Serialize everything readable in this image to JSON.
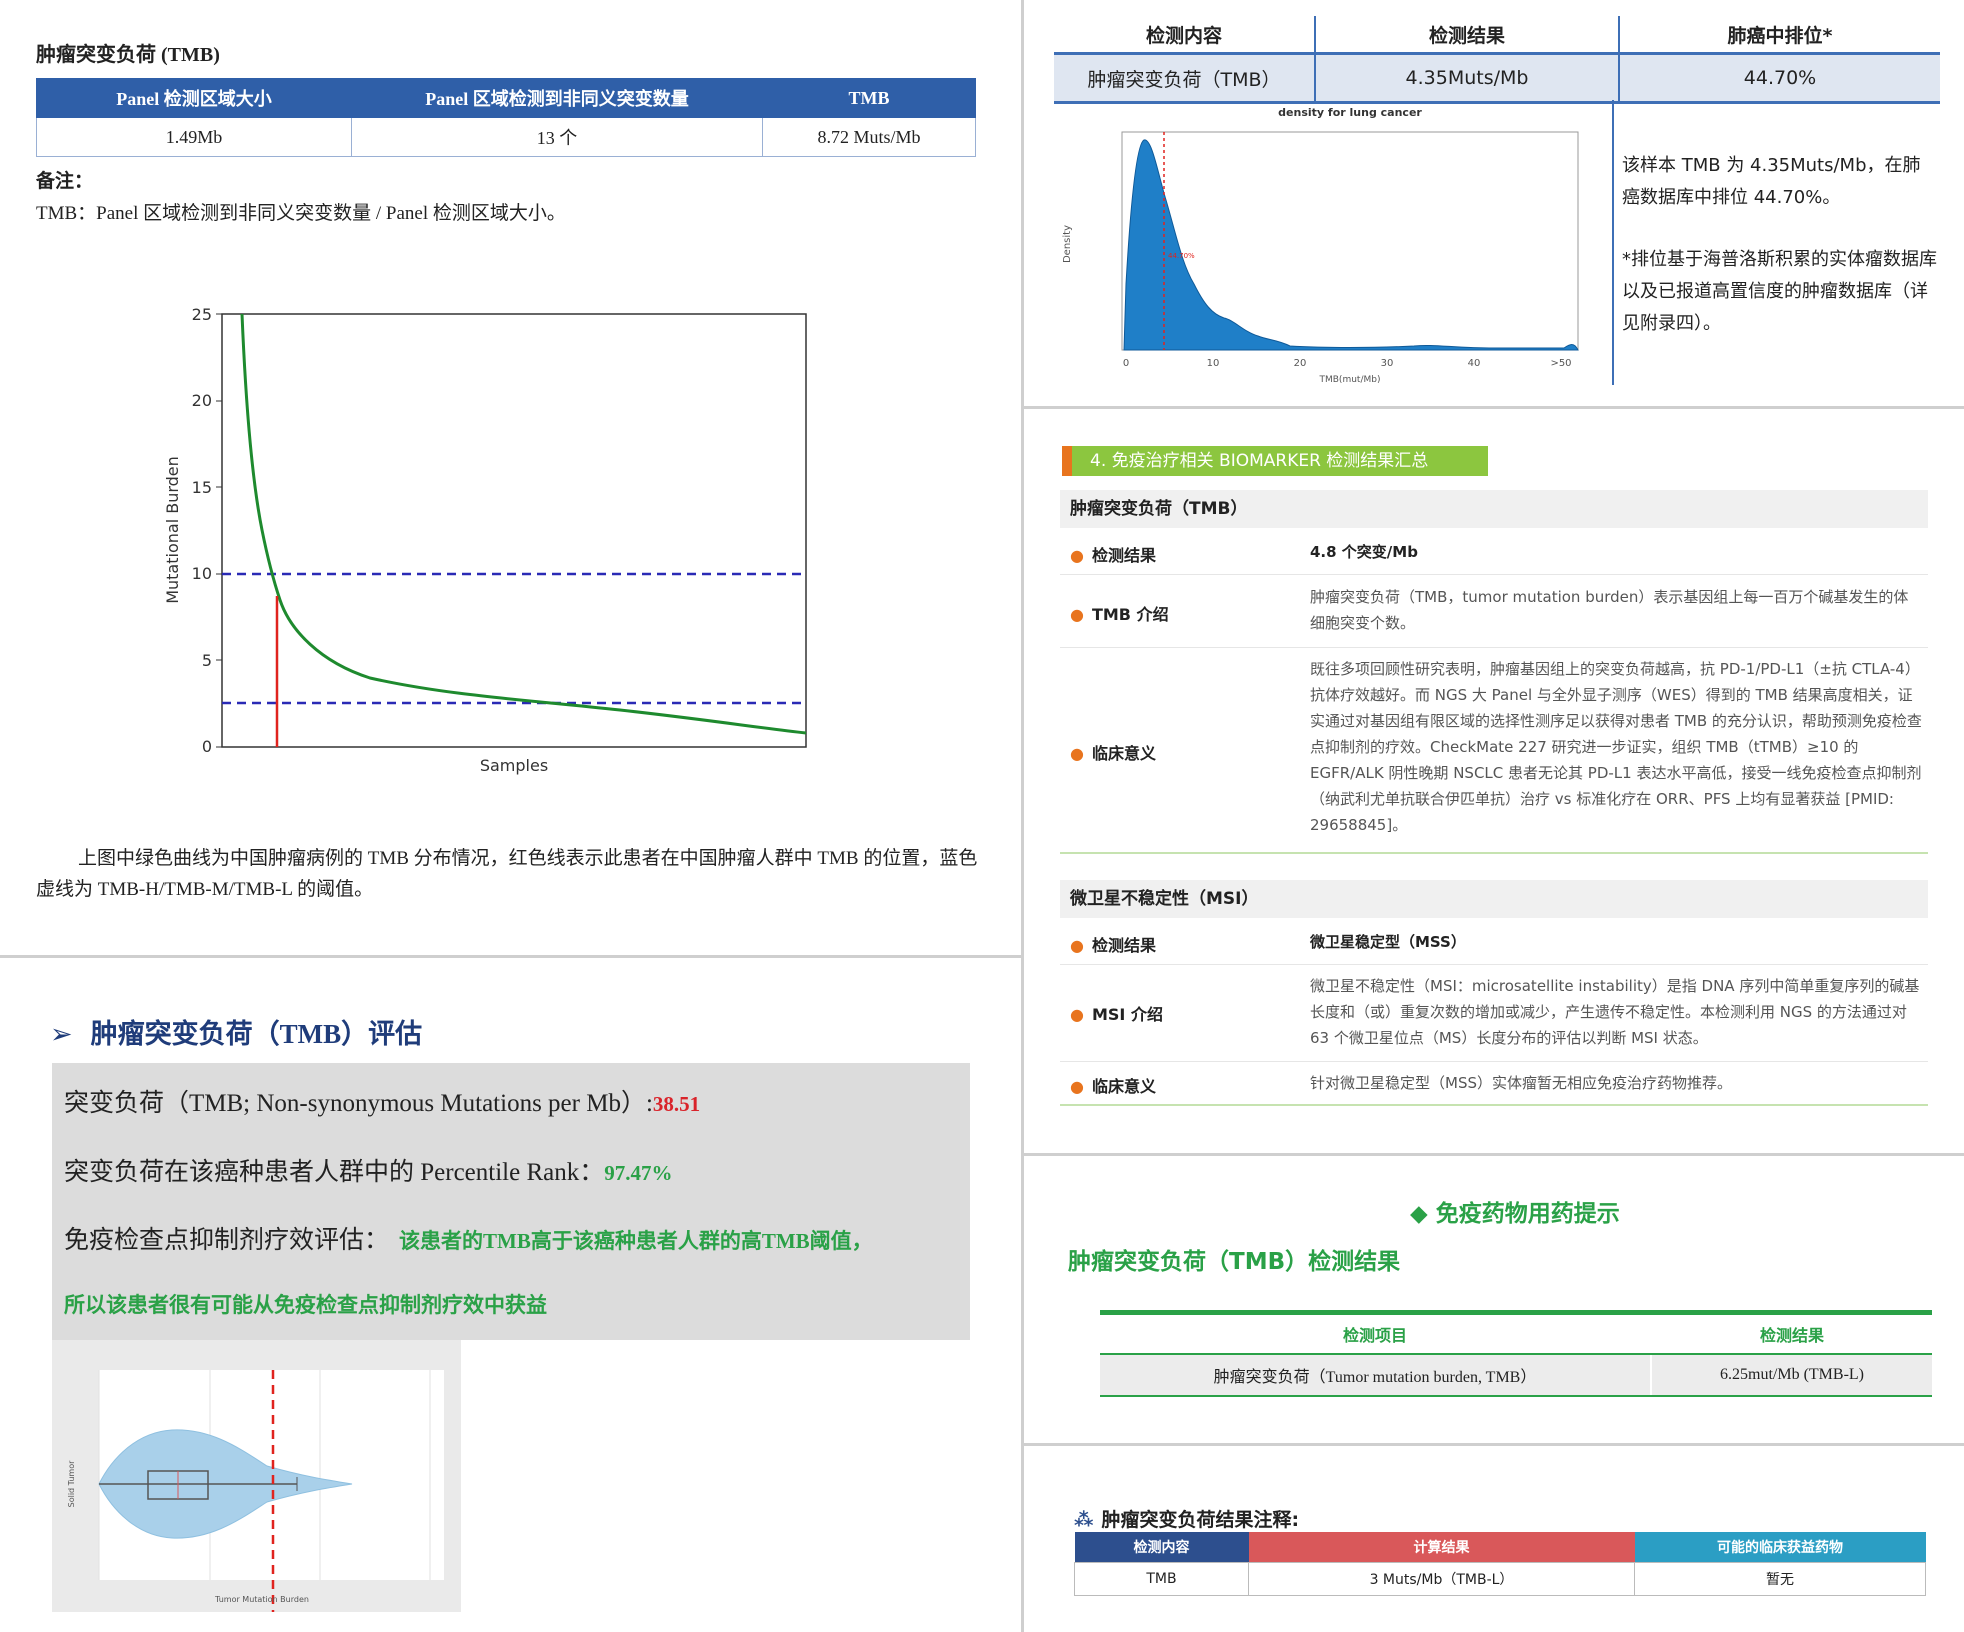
{
  "p1": {
    "title": "肿瘤突变负荷 (TMB)",
    "headers": [
      "Panel 检测区域大小",
      "Panel 区域检测到非同义突变数量",
      "TMB"
    ],
    "row": [
      "1.49Mb",
      "13 个",
      "8.72 Muts/Mb"
    ],
    "note_label": "备注：",
    "definition": "TMB：Panel 区域检测到非同义突变数量 / Panel 检测区域大小。",
    "chart": {
      "ylabel": "Mutational Burden",
      "xlabel": "Samples",
      "yticks": [
        "0",
        "5",
        "10",
        "15",
        "20",
        "25"
      ]
    },
    "caption": "上图中绿色曲线为中国肿瘤病例的 TMB 分布情况，红色线表示此患者在中国肿瘤人群中 TMB 的位置，蓝色虚线为 TMB-H/TMB-M/TMB-L 的阈值。"
  },
  "p2": {
    "heading": "肿瘤突变负荷（TMB）评估",
    "line1_label": "突变负荷（TMB; Non-synonymous Mutations per Mb）:",
    "line1_value": "38.51",
    "line2_label": "突变负荷在该癌种患者人群中的 Percentile Rank：",
    "line2_value": "97.47%",
    "line3_label": "免疫检查点抑制剂疗效评估：",
    "line3_value": "该患者的TMB高于该癌种患者人群的高TMB阈值，",
    "line4_value": "所以该患者很有可能从免疫检查点抑制剂疗效中获益",
    "violin": {
      "ylabel": "Solid Tumor",
      "xlabel": "Tumor Mutation Burden"
    }
  },
  "p3": {
    "headers": [
      "检测内容",
      "检测结果",
      "肺癌中排位*"
    ],
    "row": [
      "肿瘤突变负荷（TMB）",
      "4.35Muts/Mb",
      "44.70%"
    ],
    "chart": {
      "title": "density for lung cancer",
      "ylabel": "Density",
      "xlabel": "TMB(mut/Mb)",
      "xticks": [
        "0",
        "10",
        "20",
        "30",
        "40",
        ">50"
      ],
      "marker_label": "44.70%"
    },
    "text1": "该样本 TMB 为 4.35Muts/Mb，在肺癌数据库中排位 44.70%。",
    "text2": "*排位基于海普洛斯积累的实体瘤数据库以及已报道高置信度的肿瘤数据库（详见附录四）。"
  },
  "p4": {
    "banner": "4. 免疫治疗相关 BIOMARKER 检测结果汇总",
    "tmb_section": "肿瘤突变负荷（TMB）",
    "tmb_result_label": "检测结果",
    "tmb_result_value": "4.8 个突变/Mb",
    "tmb_intro_label": "TMB 介绍",
    "tmb_intro_value": "肿瘤突变负荷（TMB，tumor mutation burden）表示基因组上每一百万个碱基发生的体细胞突变个数。",
    "tmb_clin_label": "临床意义",
    "tmb_clin_value": "既往多项回顾性研究表明，肿瘤基因组上的突变负荷越高，抗 PD-1/PD-L1（±抗 CTLA-4）抗体疗效越好。而 NGS 大 Panel 与全外显子测序（WES）得到的 TMB 结果高度相关，证实通过对基因组有限区域的选择性测序足以获得对患者 TMB 的充分认识，帮助预测免疫检查点抑制剂的疗效。CheckMate 227 研究进一步证实，组织 TMB（tTMB）≥10 的 EGFR/ALK 阴性晚期 NSCLC 患者无论其 PD-L1 表达水平高低，接受一线免疫检查点抑制剂（纳武利尤单抗联合伊匹单抗）治疗 vs 标准化疗在 ORR、PFS 上均有显著获益 [PMID: 29658845]。",
    "msi_section": "微卫星不稳定性（MSI）",
    "msi_result_label": "检测结果",
    "msi_result_value": "微卫星稳定型（MSS）",
    "msi_intro_label": "MSI 介绍",
    "msi_intro_value": "微卫星不稳定性（MSI：microsatellite instability）是指 DNA 序列中简单重复序列的碱基长度和（或）重复次数的增加或减少，产生遗传不稳定性。本检测利用 NGS 的方法通过对 63 个微卫星位点（MS）长度分布的评估以判断 MSI 状态。",
    "msi_clin_label": "临床意义",
    "msi_clin_value": "针对微卫星稳定型（MSS）实体瘤暂无相应免疫治疗药物推荐。"
  },
  "p5": {
    "heading": "◆ 免疫药物用药提示",
    "subheading": "肿瘤突变负荷（TMB）检测结果",
    "headers": [
      "检测项目",
      "检测结果"
    ],
    "row_label": "肿瘤突变负荷（Tumor mutation burden, TMB）",
    "row_value": "6.25mut/Mb (TMB-L)"
  },
  "p6": {
    "title": "肿瘤突变负荷结果注释:",
    "headers": [
      "检测内容",
      "计算结果",
      "可能的临床获益药物"
    ],
    "row": [
      "TMB",
      "3 Muts/Mb（TMB-L）",
      "暂无"
    ]
  },
  "colors": {
    "blue_header": "#2f5fa8",
    "green": "#2aa147",
    "red": "#d9232a",
    "orange": "#e8741e",
    "teal": "#2b9ec4",
    "rose": "#d9585a",
    "navy": "#2d4f8e"
  },
  "icons": [
    "chevron-right-icon",
    "diamond-icon",
    "molecule-icon"
  ]
}
